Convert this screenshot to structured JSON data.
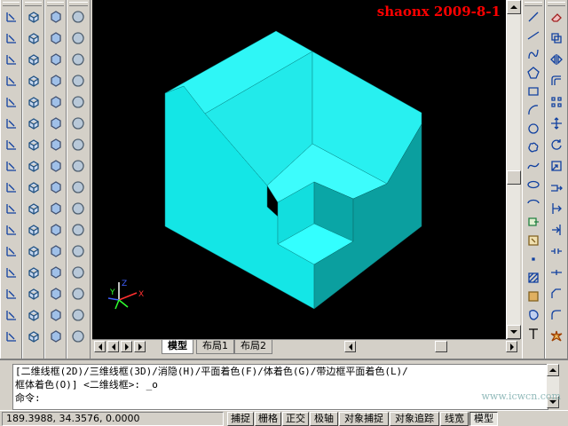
{
  "stamp": "shaonx 2009-8-1",
  "tabs": [
    {
      "label": "模型",
      "active": true
    },
    {
      "label": "布局1",
      "active": false
    },
    {
      "label": "布局2",
      "active": false
    }
  ],
  "command": {
    "line1": "[二维线框(2D)/三维线框(3D)/消隐(H)/平面着色(F)/体着色(G)/带边框平面着色(L)/",
    "line2": "框体着色(O)] <二维线框>: _o",
    "prompt": "命令:"
  },
  "status": {
    "coords": "189.3988, 34.3576, 0.0000",
    "buttons": [
      "捕捉",
      "栅格",
      "正交",
      "极轴",
      "对象捕捉",
      "对象追踪",
      "线宽",
      "模型"
    ]
  },
  "ucs": {
    "x": "X",
    "y": "Y",
    "z": "Z"
  },
  "colors": {
    "solid_light": "#33ffff",
    "solid_mid": "#14e6e6",
    "solid_dark": "#0aa6a6",
    "canvas": "#000000",
    "stamp": "#ff0000"
  },
  "watermark": "www.icwcn.com",
  "toolbar_icons": {
    "col1": [
      "dimension-icon",
      "dimension-icon",
      "dimension-icon",
      "dimension-icon",
      "dimension-icon",
      "dimension-icon",
      "dimension-icon",
      "dimension-icon",
      "dimension-icon",
      "dimension-icon",
      "dimension-icon",
      "dimension-icon",
      "dimension-icon",
      "dimension-icon",
      "dimension-icon",
      "dimension-icon"
    ],
    "col2": [
      "box-icon",
      "box-icon",
      "box-icon",
      "box-icon",
      "box-icon",
      "box-icon",
      "box-icon",
      "box-icon",
      "box-icon",
      "box-icon",
      "box-icon",
      "box-icon",
      "box-icon",
      "box-icon",
      "box-icon",
      "box-icon"
    ],
    "col3": [
      "solid-icon",
      "solid-icon",
      "solid-icon",
      "solid-icon",
      "solid-icon",
      "solid-icon",
      "solid-icon",
      "solid-icon",
      "solid-icon",
      "solid-icon",
      "solid-icon",
      "solid-icon",
      "solid-icon",
      "solid-icon",
      "solid-icon",
      "solid-icon"
    ],
    "col4": [
      "sphere-icon",
      "sphere-icon",
      "sphere-icon",
      "sphere-icon",
      "sphere-icon",
      "sphere-icon",
      "sphere-icon",
      "sphere-icon",
      "sphere-icon",
      "sphere-icon",
      "sphere-icon",
      "sphere-icon",
      "sphere-icon",
      "sphere-icon",
      "sphere-icon",
      "sphere-icon"
    ],
    "draw": [
      "line-icon",
      "construction-line-icon",
      "polyline-icon",
      "polygon-icon",
      "rectangle-icon",
      "arc-icon",
      "circle-icon",
      "revcloud-icon",
      "spline-icon",
      "ellipse-icon",
      "ellipse-arc-icon",
      "insert-block-icon",
      "make-block-icon",
      "point-icon",
      "hatch-icon",
      "gradient-icon",
      "region-icon",
      "text-icon"
    ],
    "modify": [
      "erase-icon",
      "copy-icon",
      "mirror-icon",
      "offset-icon",
      "array-icon",
      "move-icon",
      "rotate-icon",
      "scale-icon",
      "stretch-icon",
      "trim-icon",
      "extend-icon",
      "break-icon",
      "join-icon",
      "chamfer-icon",
      "fillet-icon",
      "explode-icon"
    ]
  }
}
